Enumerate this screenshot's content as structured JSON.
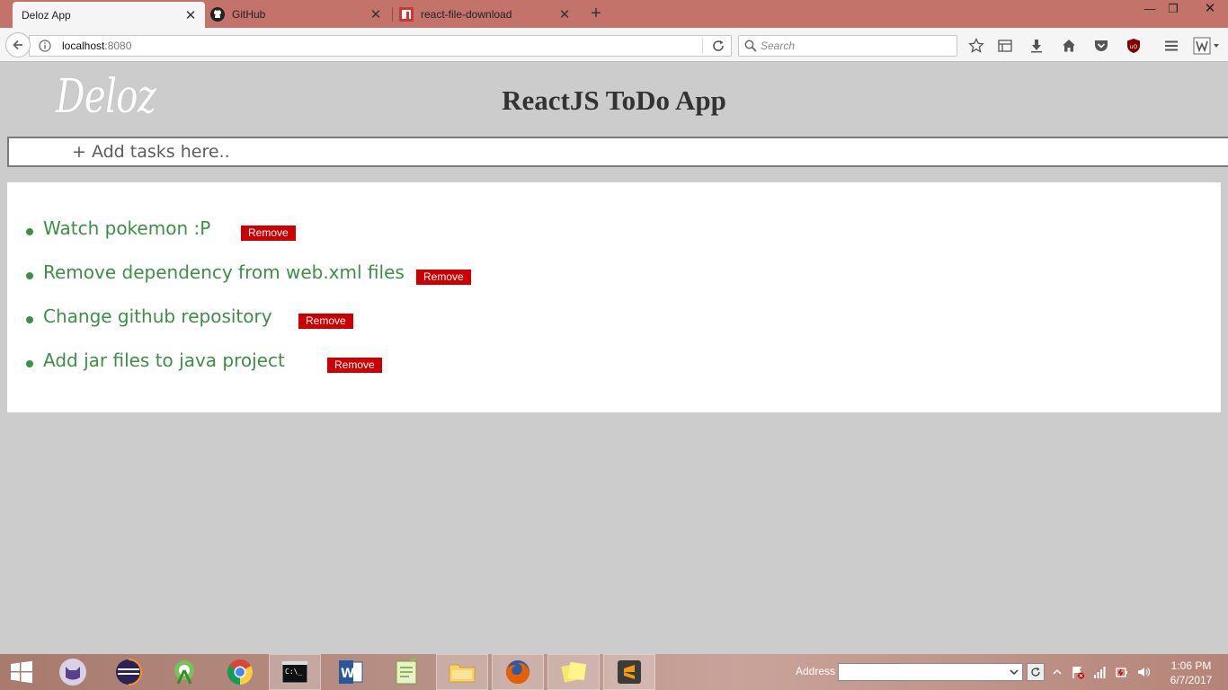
{
  "browser": {
    "tabs": [
      {
        "title": "Deloz App",
        "active": true
      },
      {
        "title": "GitHub",
        "active": false
      },
      {
        "title": "react-file-download",
        "active": false
      }
    ],
    "url_host": "localhost",
    "url_port": ":8080",
    "search_placeholder": "Search"
  },
  "app": {
    "logo": "Deloz",
    "title": "ReactJS ToDo App",
    "input_placeholder": "+ Add tasks here..",
    "tasks": [
      {
        "text": "Watch pokemon :P",
        "remove_label": "Remove"
      },
      {
        "text": "Remove dependency from web.xml files",
        "remove_label": "Remove"
      },
      {
        "text": "Change github repository",
        "remove_label": "Remove"
      },
      {
        "text": "Add jar files to java project",
        "remove_label": "Remove"
      }
    ],
    "colors": {
      "task_text": "#3e8e47",
      "remove_button": "#cc0000",
      "background": "#cccccc"
    }
  },
  "taskbar": {
    "apps": [
      "cat-app-icon",
      "eclipse-icon",
      "android-studio-icon",
      "chrome-icon",
      "command-prompt-icon",
      "word-icon",
      "notepad-plus-icon",
      "file-explorer-icon",
      "firefox-icon",
      "sticky-notes-icon",
      "sublime-text-icon"
    ],
    "address_label": "Address",
    "time": "1:06 PM",
    "date": "6/7/2017"
  }
}
